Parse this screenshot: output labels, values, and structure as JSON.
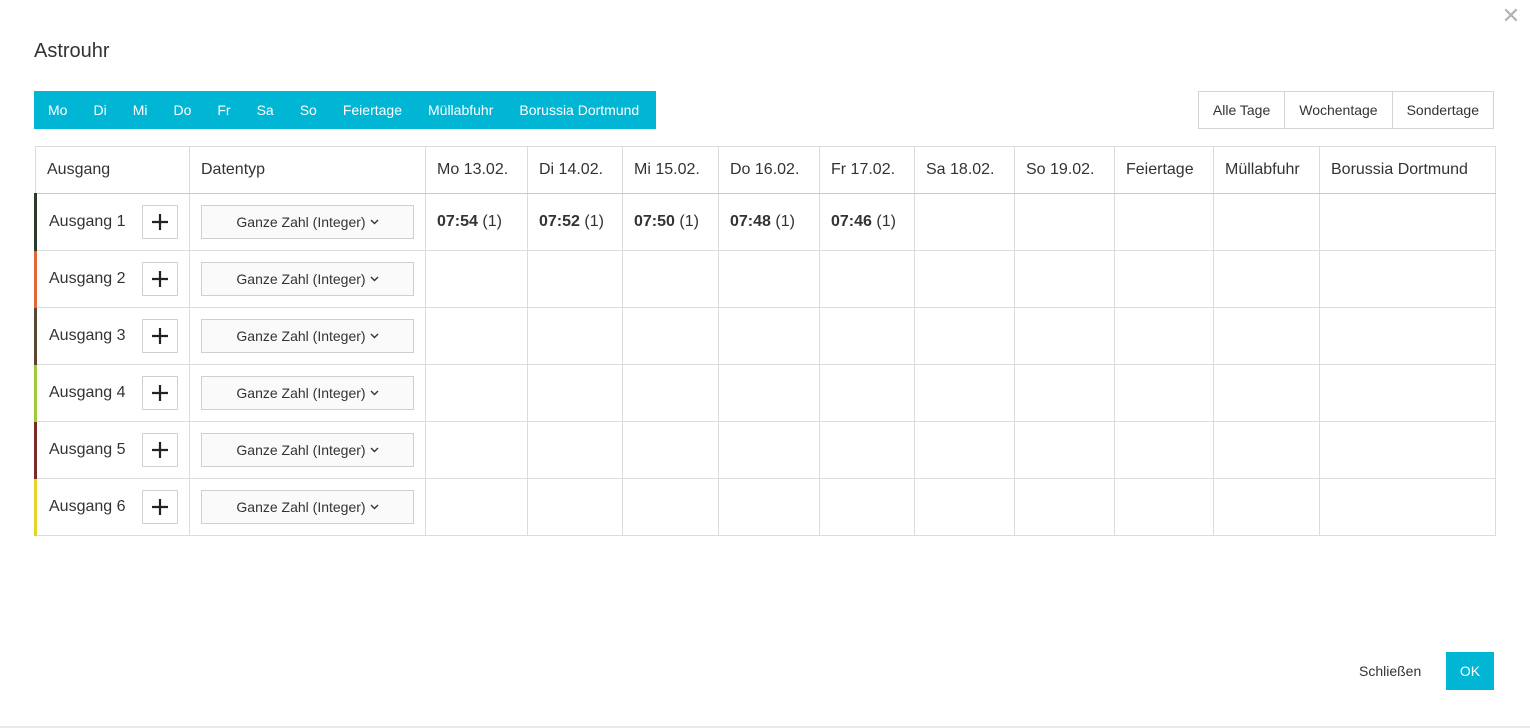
{
  "dialog": {
    "title": "Astrouhr",
    "close_icon": "close-icon"
  },
  "day_tabs": [
    "Mo",
    "Di",
    "Mi",
    "Do",
    "Fr",
    "Sa",
    "So",
    "Feiertage",
    "Müllabfuhr",
    "Borussia Dortmund"
  ],
  "view_buttons": [
    "Alle Tage",
    "Wochentage",
    "Sondertage"
  ],
  "table": {
    "headers": [
      "Ausgang",
      "Datentyp",
      "Mo 13.02.",
      "Di 14.02.",
      "Mi 15.02.",
      "Do 16.02.",
      "Fr 17.02.",
      "Sa 18.02.",
      "So 19.02.",
      "Feiertage",
      "Müllabfuhr",
      "Borussia Dortmund"
    ],
    "rows": [
      {
        "label": "Ausgang 1",
        "color": "#2b3a2f",
        "datatype": "Ganze Zahl (Integer)",
        "cells": [
          {
            "time": "07:54",
            "count": "(1)"
          },
          {
            "time": "07:52",
            "count": "(1)"
          },
          {
            "time": "07:50",
            "count": "(1)"
          },
          {
            "time": "07:48",
            "count": "(1)"
          },
          {
            "time": "07:46",
            "count": "(1)"
          },
          {
            "time": "",
            "count": ""
          },
          {
            "time": "",
            "count": ""
          },
          {
            "time": "",
            "count": ""
          },
          {
            "time": "",
            "count": ""
          },
          {
            "time": "",
            "count": ""
          }
        ]
      },
      {
        "label": "Ausgang 2",
        "color": "#e0673a",
        "datatype": "Ganze Zahl (Integer)",
        "cells": []
      },
      {
        "label": "Ausgang 3",
        "color": "#5a4632",
        "datatype": "Ganze Zahl (Integer)",
        "cells": []
      },
      {
        "label": "Ausgang 4",
        "color": "#9ccc3a",
        "datatype": "Ganze Zahl (Integer)",
        "cells": []
      },
      {
        "label": "Ausgang 5",
        "color": "#7a2b23",
        "datatype": "Ganze Zahl (Integer)",
        "cells": []
      },
      {
        "label": "Ausgang 6",
        "color": "#e6d42a",
        "datatype": "Ganze Zahl (Integer)",
        "cells": []
      }
    ]
  },
  "footer": {
    "close_label": "Schließen",
    "ok_label": "OK"
  },
  "colors": {
    "accent": "#00b6d4"
  }
}
